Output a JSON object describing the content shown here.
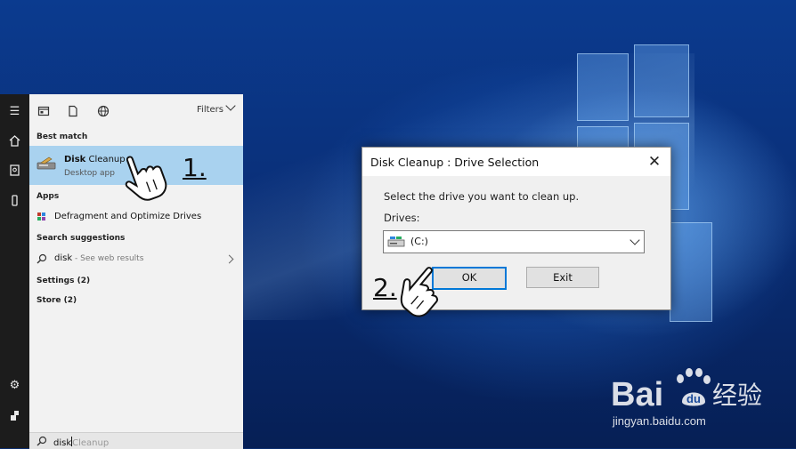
{
  "start_menu": {
    "top_icons": [
      "apps-icon",
      "document-icon",
      "globe-icon"
    ],
    "filters_label": "Filters",
    "best_match_heading": "Best match",
    "best_match": {
      "title_bold": "Disk",
      "title_rest": " Cleanup",
      "subtitle": "Desktop app"
    },
    "apps_heading": "Apps",
    "apps": [
      {
        "label": "Defragment and Optimize Drives"
      }
    ],
    "search_suggestions_heading": "Search suggestions",
    "suggestion": {
      "query": "disk",
      "hint": " - See web results"
    },
    "settings_heading": "Settings (2)",
    "store_heading": "Store (2)",
    "search_box": {
      "typed": "disk",
      "ghost": "Cleanup"
    }
  },
  "dialog": {
    "title": "Disk Cleanup : Drive Selection",
    "close_glyph": "✕",
    "prompt": "Select the drive you want to clean up.",
    "drives_label": "Drives:",
    "selected_drive": "(C:)",
    "ok_label": "OK",
    "exit_label": "Exit"
  },
  "steps": {
    "step1": "1.",
    "step2": "2."
  },
  "watermark": {
    "brand": "Bai",
    "brand_cn": "经验",
    "url": "jingyan.baidu.com"
  },
  "colors": {
    "highlight": "#a9d2ef",
    "accent": "#0078d7",
    "taskbar": "#1c1c1c"
  }
}
